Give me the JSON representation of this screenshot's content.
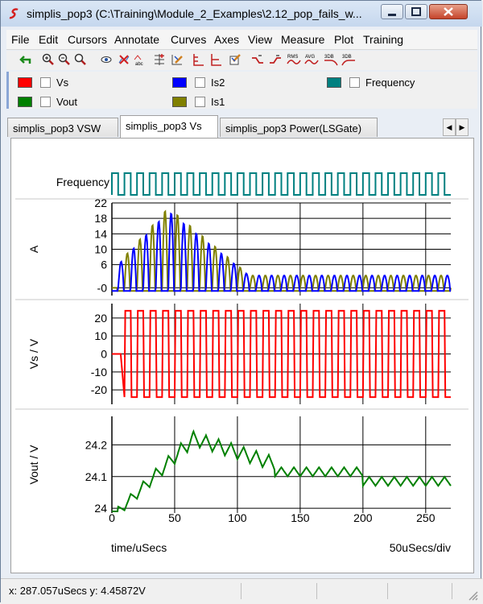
{
  "window": {
    "title": "simplis_pop3 (C:\\Training\\Module_2_Examples\\2.12_pop_fails_w..."
  },
  "menu": {
    "items": [
      "File",
      "Edit",
      "Cursors",
      "Annotate",
      "Curves",
      "Axes",
      "View",
      "Measure",
      "Plot",
      "Training"
    ]
  },
  "toolbar": {
    "icons": [
      "undo-arrow-icon",
      "zoom-in-icon",
      "zoom-out-icon",
      "zoom-fit-icon",
      "eye-icon",
      "delete-curve-icon",
      "rename-curve-icon",
      "add-grid-icon",
      "edit-axis-icon",
      "stack-axis-icon",
      "new-axis-icon",
      "properties-icon",
      "rise-time-icon",
      "fall-time-icon",
      "rms-icon",
      "avg-icon",
      "3db-high-icon",
      "3db-low-icon"
    ],
    "rms_label": "RMS",
    "avg_label": "AVG",
    "db1_label": "3DB",
    "db2_label": "3DB"
  },
  "legend": {
    "items": [
      {
        "label": "Vs",
        "color": "#ff0000"
      },
      {
        "label": "Is2",
        "color": "#0000ff"
      },
      {
        "label": "Frequency",
        "color": "#008080"
      },
      {
        "label": "Vout",
        "color": "#008000"
      },
      {
        "label": "Is1",
        "color": "#808000"
      }
    ]
  },
  "tabs": [
    {
      "label": "simplis_pop3 VSW"
    },
    {
      "label": "simplis_pop3 Vs",
      "active": true
    },
    {
      "label": "simplis_pop3 Power(LSGate)"
    }
  ],
  "status": {
    "text": "x: 287.057uSecs  y: 4.45872V"
  },
  "chart_data": [
    {
      "type": "line",
      "title": "",
      "ylabel": "Frequency",
      "digital": true,
      "series": [
        {
          "name": "Frequency",
          "color": "#008080",
          "period_us": 10
        }
      ],
      "xlim": [
        0,
        270
      ]
    },
    {
      "type": "line",
      "ylabel": "A",
      "ylim": [
        -2,
        22
      ],
      "yticks": [
        22,
        18,
        14,
        10,
        6,
        0
      ],
      "ytick_labels": [
        "22",
        "18",
        "14",
        "10",
        "6",
        "-0"
      ],
      "series": [
        {
          "name": "Is2",
          "color": "#0000ff"
        },
        {
          "name": "Is1",
          "color": "#808000"
        }
      ],
      "xlim": [
        0,
        270
      ]
    },
    {
      "type": "line",
      "ylabel": "Vs / V",
      "ylim": [
        -28,
        28
      ],
      "yticks": [
        20,
        10,
        0,
        -10,
        -20
      ],
      "ytick_labels": [
        "20",
        "10",
        "0",
        "-10",
        "-20"
      ],
      "series": [
        {
          "name": "Vs",
          "color": "#ff0000",
          "high": 24,
          "low": -24
        }
      ],
      "xlim": [
        0,
        270
      ]
    },
    {
      "type": "line",
      "ylabel": "Vout / V",
      "ylim": [
        23.985,
        24.29
      ],
      "yticks": [
        24.2,
        24.1,
        24
      ],
      "ytick_labels": [
        "24.2",
        "24.1",
        "24"
      ],
      "series": [
        {
          "name": "Vout",
          "color": "#008000"
        }
      ],
      "xlim": [
        0,
        270
      ],
      "xticks": [
        0,
        50,
        100,
        150,
        200,
        250
      ],
      "xtick_labels": [
        "0",
        "50",
        "100",
        "150",
        "200",
        "250"
      ],
      "xlabel": "time/uSecs",
      "xdiv_label": "50uSecs/div"
    }
  ]
}
